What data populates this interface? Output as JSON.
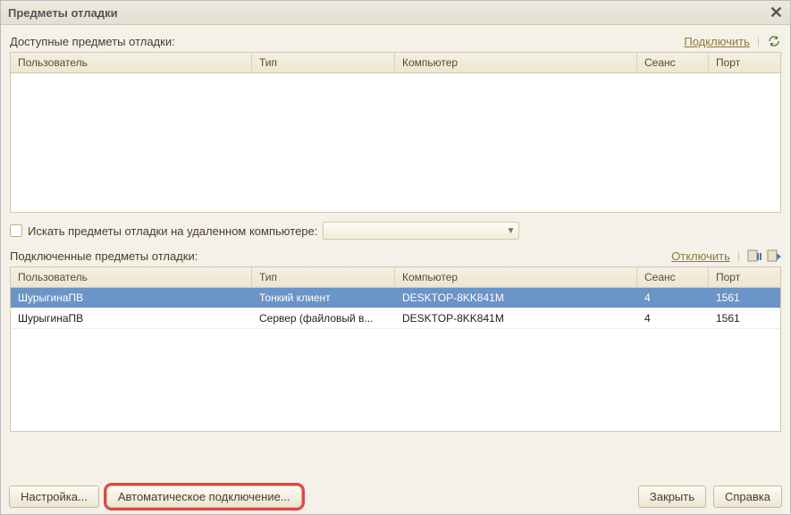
{
  "dialog": {
    "title": "Предметы отладки"
  },
  "available": {
    "label": "Доступные предметы отладки:",
    "connect_label": "Подключить",
    "columns": {
      "user": "Пользователь",
      "type": "Тип",
      "computer": "Компьютер",
      "session": "Сеанс",
      "port": "Порт"
    },
    "rows": []
  },
  "remote_search": {
    "label": "Искать предметы отладки на удаленном компьютере:",
    "value": ""
  },
  "connected": {
    "label": "Подключенные предметы отладки:",
    "disconnect_label": "Отключить",
    "columns": {
      "user": "Пользователь",
      "type": "Тип",
      "computer": "Компьютер",
      "session": "Сеанс",
      "port": "Порт"
    },
    "rows": [
      {
        "user": "ШурыгинаПВ",
        "type": "Тонкий клиент",
        "computer": "DESKTOP-8KK841M",
        "session": "4",
        "port": "1561",
        "selected": true
      },
      {
        "user": "ШурыгинаПВ",
        "type": "Сервер (файловый в...",
        "computer": "DESKTOP-8KK841M",
        "session": "4",
        "port": "1561",
        "selected": false
      }
    ]
  },
  "buttons": {
    "settings": "Настройка...",
    "auto_connect": "Автоматическое подключение...",
    "close": "Закрыть",
    "help": "Справка"
  }
}
